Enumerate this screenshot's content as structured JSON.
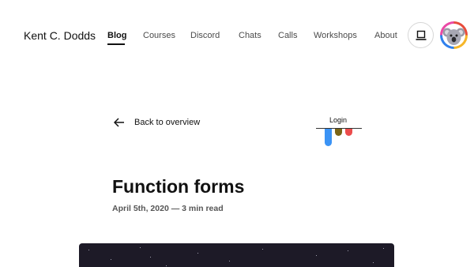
{
  "header": {
    "brand": "Kent C. Dodds",
    "nav": [
      "Blog",
      "Courses",
      "Discord",
      "Chats",
      "Calls",
      "Workshops",
      "About"
    ],
    "active_nav": "Blog",
    "theme_icon": "laptop-icon",
    "avatar_icon": "koala-avatar"
  },
  "article": {
    "back_label": "Back to overview",
    "login_label": "Login",
    "login_bar_colors": [
      "#3b93f5",
      "#7a6416",
      "#ec4c4c"
    ],
    "title": "Function forms",
    "meta": "April 5th, 2020 — 3 min read",
    "hero_color": "#1d1a27"
  }
}
